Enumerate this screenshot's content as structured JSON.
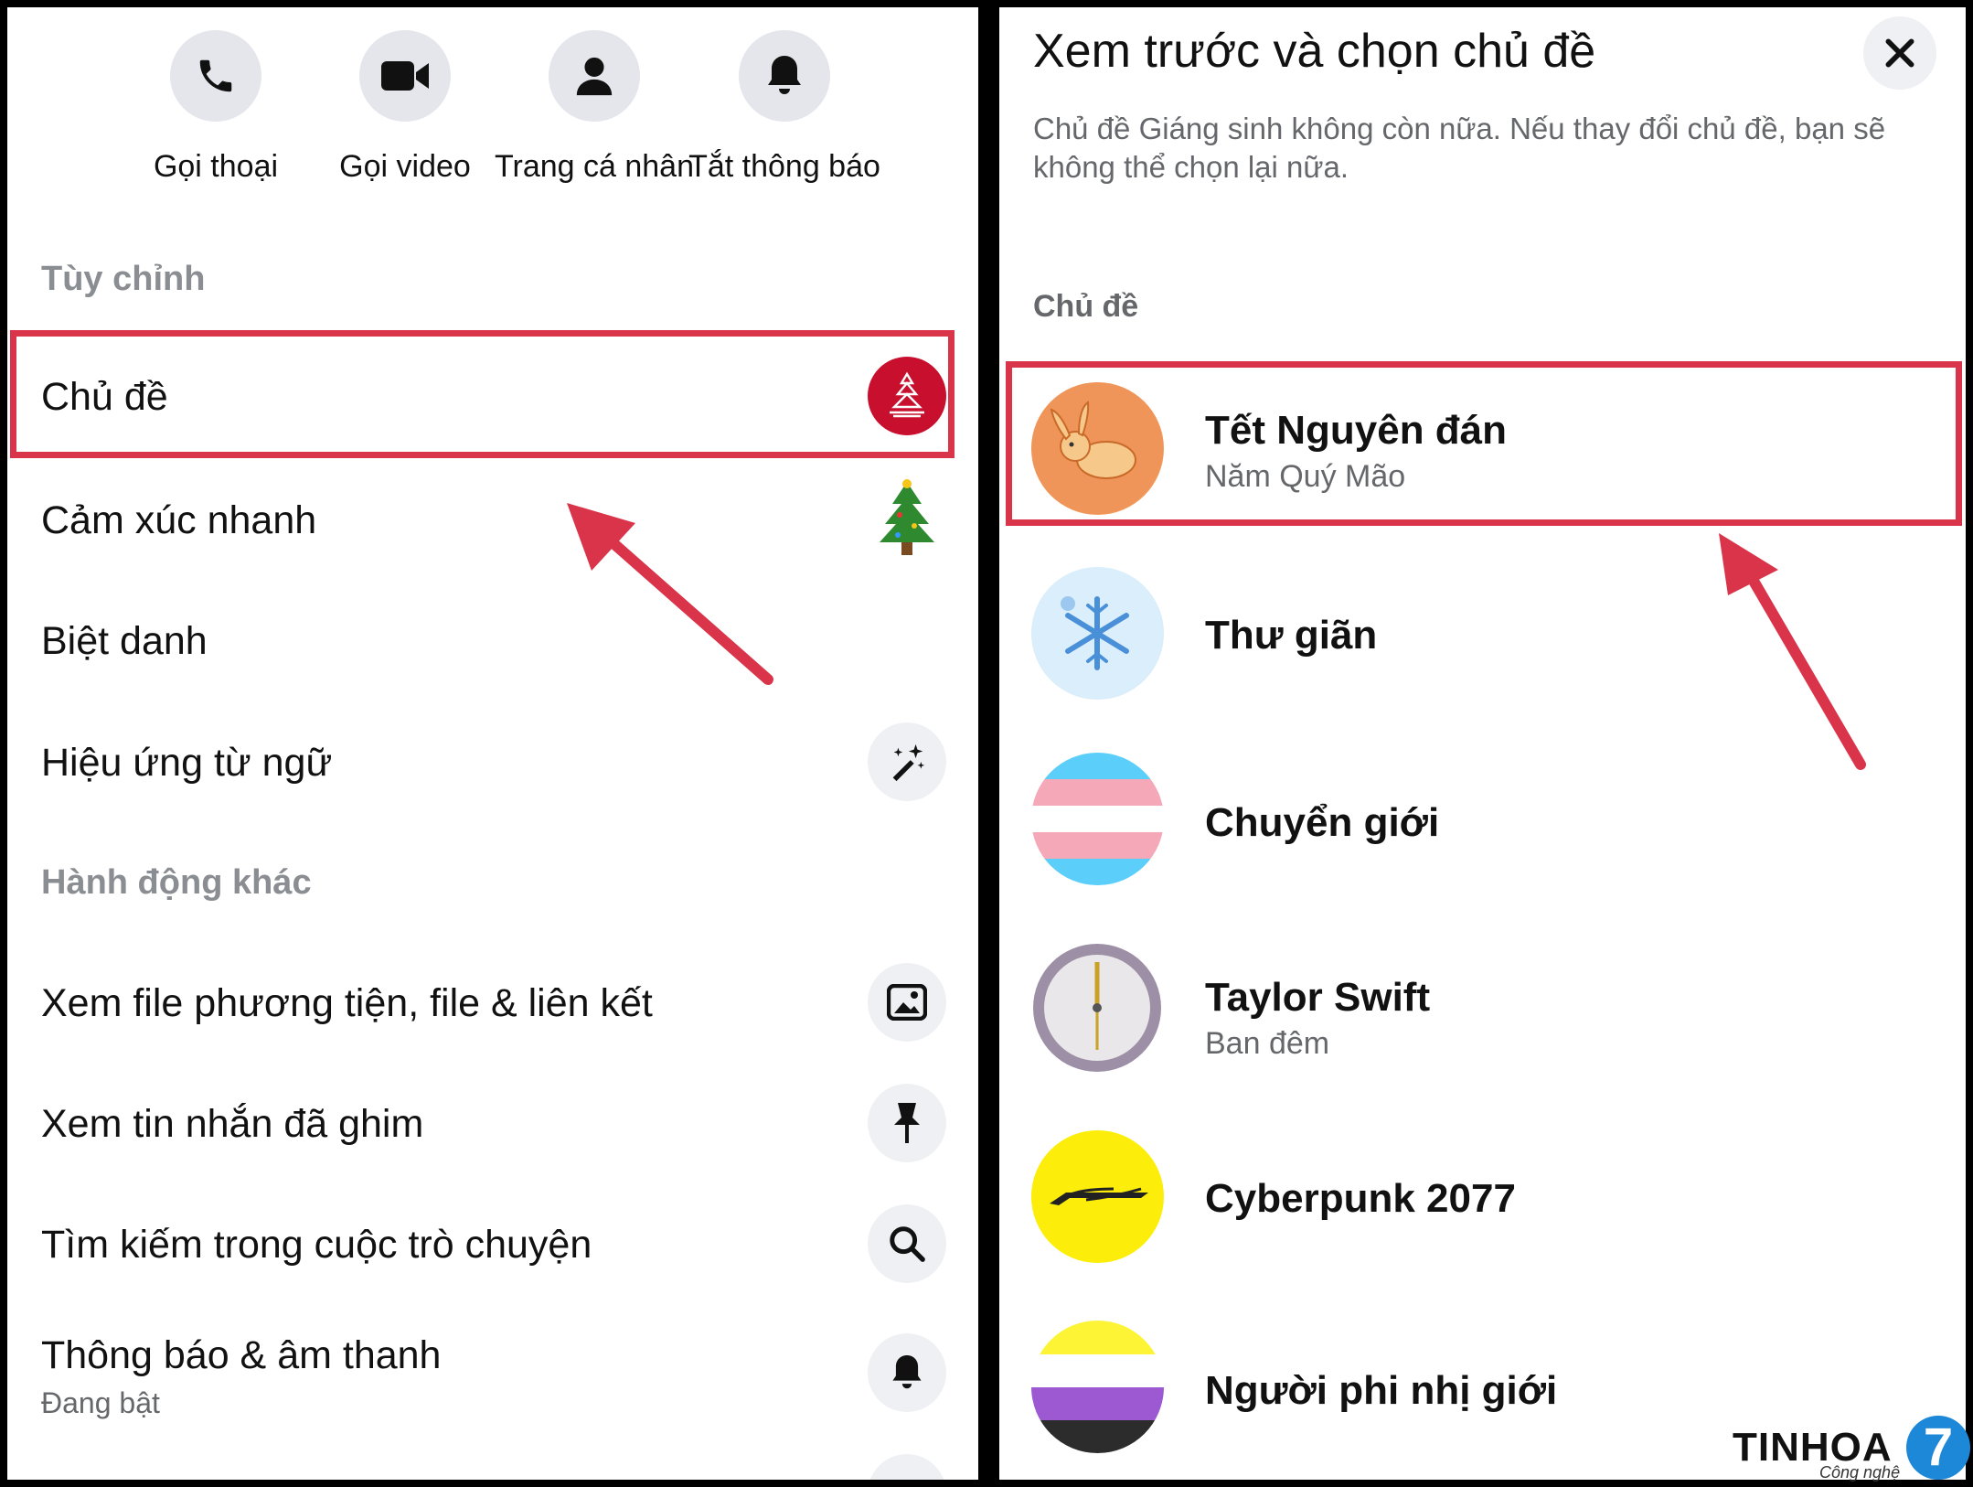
{
  "left": {
    "actions": [
      {
        "label": "Gọi thoại",
        "icon": "phone-icon"
      },
      {
        "label": "Gọi video",
        "icon": "video-camera-icon"
      },
      {
        "label": "Trang cá nhân",
        "icon": "person-icon"
      },
      {
        "label": "Tắt thông báo",
        "icon": "bell-icon"
      }
    ],
    "customize_header": "Tùy chỉnh",
    "items": [
      {
        "label": "Chủ đề",
        "icon": "christmas-sweater-theme-icon"
      },
      {
        "label": "Cảm xúc nhanh",
        "icon": "christmas-tree-icon"
      },
      {
        "label": "Biệt danh"
      },
      {
        "label": "Hiệu ứng từ ngữ",
        "icon": "magic-wand-icon"
      }
    ],
    "other_header": "Hành động khác",
    "other_items": [
      {
        "label": "Xem file phương tiện, file & liên kết",
        "icon": "image-icon"
      },
      {
        "label": "Xem tin nhắn đã ghim",
        "icon": "pin-icon"
      },
      {
        "label": "Tìm kiếm trong cuộc trò chuyện",
        "icon": "search-icon"
      },
      {
        "label": "Thông báo & âm thanh",
        "sub": "Đang bật",
        "icon": "bell-icon"
      }
    ]
  },
  "right": {
    "title": "Xem trước và chọn chủ đề",
    "description": "Chủ đề Giáng sinh không còn nữa. Nếu thay đổi chủ đề, bạn sẽ không thể chọn lại nữa.",
    "section": "Chủ đề",
    "themes": [
      {
        "name": "Tết Nguyên đán",
        "sub": "Năm Quý Mão",
        "icon": "rabbit-icon"
      },
      {
        "name": "Thư giãn",
        "icon": "snowflake-icon"
      },
      {
        "name": "Chuyển giới",
        "icon": "trans-flag-icon"
      },
      {
        "name": "Taylor Swift",
        "sub": "Ban đêm",
        "icon": "clock-icon"
      },
      {
        "name": "Cyberpunk 2077",
        "icon": "cyberpunk-logo-icon"
      },
      {
        "name": "Người phi nhị giới",
        "icon": "nonbinary-flag-icon"
      }
    ]
  },
  "watermark": {
    "brand": "TINHOA",
    "tagline": "Công nghệ",
    "badge": "7"
  },
  "colors": {
    "highlight": "#d9344a",
    "icon_bg": "#e4e6eb",
    "secondary_text": "#65676b",
    "section_text": "#8a8d91"
  }
}
